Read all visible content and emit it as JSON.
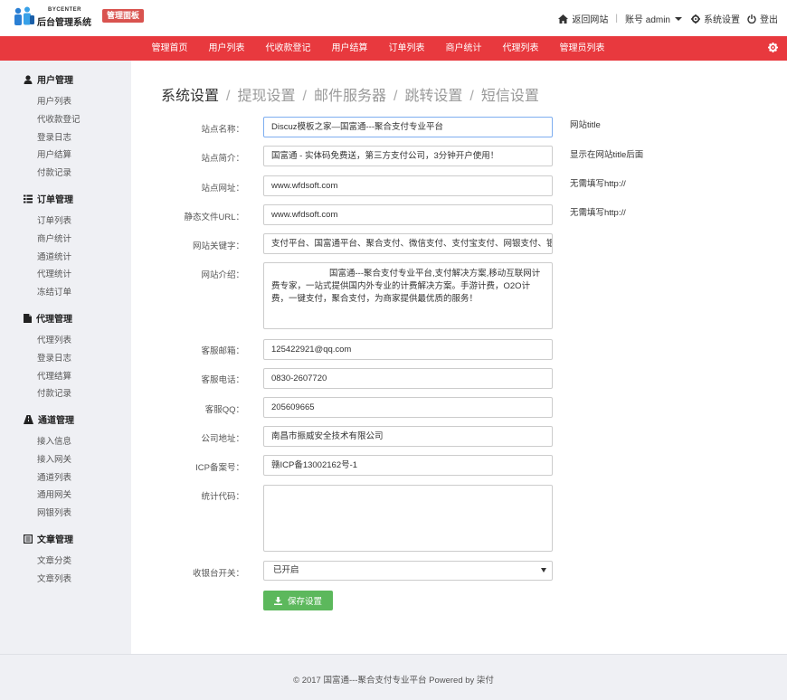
{
  "brand": {
    "logo_en": "BYCENTER",
    "logo_cn": "后台管理系统",
    "badge": "管理面板"
  },
  "topbar": {
    "home_link": "返回网站",
    "account": "账号 admin",
    "settings_link": "系统设置",
    "logout_link": "登出"
  },
  "nav": [
    {
      "label": "管理首页"
    },
    {
      "label": "用户列表"
    },
    {
      "label": "代收款登记"
    },
    {
      "label": "用户结算"
    },
    {
      "label": "订单列表"
    },
    {
      "label": "商户统计"
    },
    {
      "label": "代理列表"
    },
    {
      "label": "管理员列表"
    }
  ],
  "sidebar": {
    "sections": [
      {
        "title": "用户管理",
        "icon": "user-icon",
        "items": [
          "用户列表",
          "代收款登记",
          "登录日志",
          "用户结算",
          "付款记录"
        ]
      },
      {
        "title": "订单管理",
        "icon": "list-icon",
        "items": [
          "订单列表",
          "商户统计",
          "通道统计",
          "代理统计",
          "冻结订单"
        ]
      },
      {
        "title": "代理管理",
        "icon": "file-icon",
        "items": [
          "代理列表",
          "登录日志",
          "代理结算",
          "付款记录"
        ]
      },
      {
        "title": "通道管理",
        "icon": "road-icon",
        "items": [
          "接入信息",
          "接入网关",
          "通道列表",
          "通用网关",
          "网银列表"
        ]
      },
      {
        "title": "文章管理",
        "icon": "article-icon",
        "items": [
          "文章分类",
          "文章列表"
        ]
      }
    ]
  },
  "tabs": [
    {
      "label": "系统设置"
    },
    {
      "label": "提现设置"
    },
    {
      "label": "邮件服务器"
    },
    {
      "label": "跳转设置"
    },
    {
      "label": "短信设置"
    }
  ],
  "form": {
    "site_name": {
      "label": "站点名称：",
      "value": "Discuz模板之家—国富通---聚合支付专业平台",
      "hint": "网站title"
    },
    "site_intro": {
      "label": "站点简介：",
      "value": "国富通 - 实体码免费送，第三方支付公司，3分钟开户使用！",
      "hint": "显示在网站title后面"
    },
    "site_url": {
      "label": "站点网址：",
      "value": "www.wfdsoft.com",
      "hint": "无需填写http://"
    },
    "static_url": {
      "label": "静态文件URL：",
      "value": "www.wfdsoft.com",
      "hint": "无需填写http://"
    },
    "keywords": {
      "label": "网站关键字：",
      "value": "支付平台、国富通平台、聚合支付、微信支付、支付宝支付、网银支付、银"
    },
    "description": {
      "label": "网站介绍：",
      "value": "国富通---聚合支付专业平台,支付解决方案,移动互联网计费专家，一站式提供国内外专业的计费解决方案。手游计费，O2O计费，一键支付，聚合支付，为商家提供最优质的服务！"
    },
    "email": {
      "label": "客服邮箱：",
      "value": "125422921@qq.com"
    },
    "phone": {
      "label": "客服电话：",
      "value": "0830-2607720"
    },
    "qq": {
      "label": "客服QQ：",
      "value": "205609665"
    },
    "company": {
      "label": "公司地址：",
      "value": "南昌市振威安全技术有限公司"
    },
    "icp": {
      "label": "ICP备案号：",
      "value": "赣ICP备13002162号-1"
    },
    "stats_code": {
      "label": "统计代码：",
      "value": ""
    },
    "cashier": {
      "label": "收银台开关：",
      "value": "已开启"
    },
    "save_label": "保存设置"
  },
  "footer": {
    "text": "© 2017  国富通---聚合支付专业平台 Powered by 柒付"
  },
  "colors": {
    "nav_red": "#e8393e",
    "badge_red": "#d9534f",
    "save_green": "#5cb85c",
    "sidebar_bg": "#eff0f4"
  }
}
